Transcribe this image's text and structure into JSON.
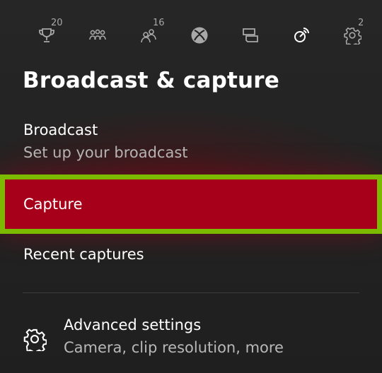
{
  "tabs": [
    {
      "name": "achievements",
      "icon": "trophy-icon",
      "badge": "20"
    },
    {
      "name": "parties",
      "icon": "party-icon",
      "badge": ""
    },
    {
      "name": "friends",
      "icon": "friends-icon",
      "badge": "16"
    },
    {
      "name": "home",
      "icon": "xbox-logo-icon",
      "badge": ""
    },
    {
      "name": "messages",
      "icon": "messages-icon",
      "badge": ""
    },
    {
      "name": "broadcast-capture",
      "icon": "broadcast-capture-icon",
      "badge": "",
      "active": true
    },
    {
      "name": "settings",
      "icon": "settings-gear-icon",
      "badge": "2"
    }
  ],
  "panel": {
    "title": "Broadcast & capture",
    "items": [
      {
        "label": "Broadcast",
        "subtitle": "Set up your broadcast"
      },
      {
        "label": "Capture",
        "selected": true
      },
      {
        "label": "Recent captures"
      },
      {
        "label": "Advanced settings",
        "subtitle": "Camera, clip resolution, more",
        "icon": "gear-icon"
      }
    ]
  },
  "colors": {
    "background": "#212121",
    "selection_fill": "#a6001a",
    "focus_border": "#7cba00",
    "secondary_text": "#b8b8b8",
    "inactive_icon": "#a8a8a8"
  }
}
